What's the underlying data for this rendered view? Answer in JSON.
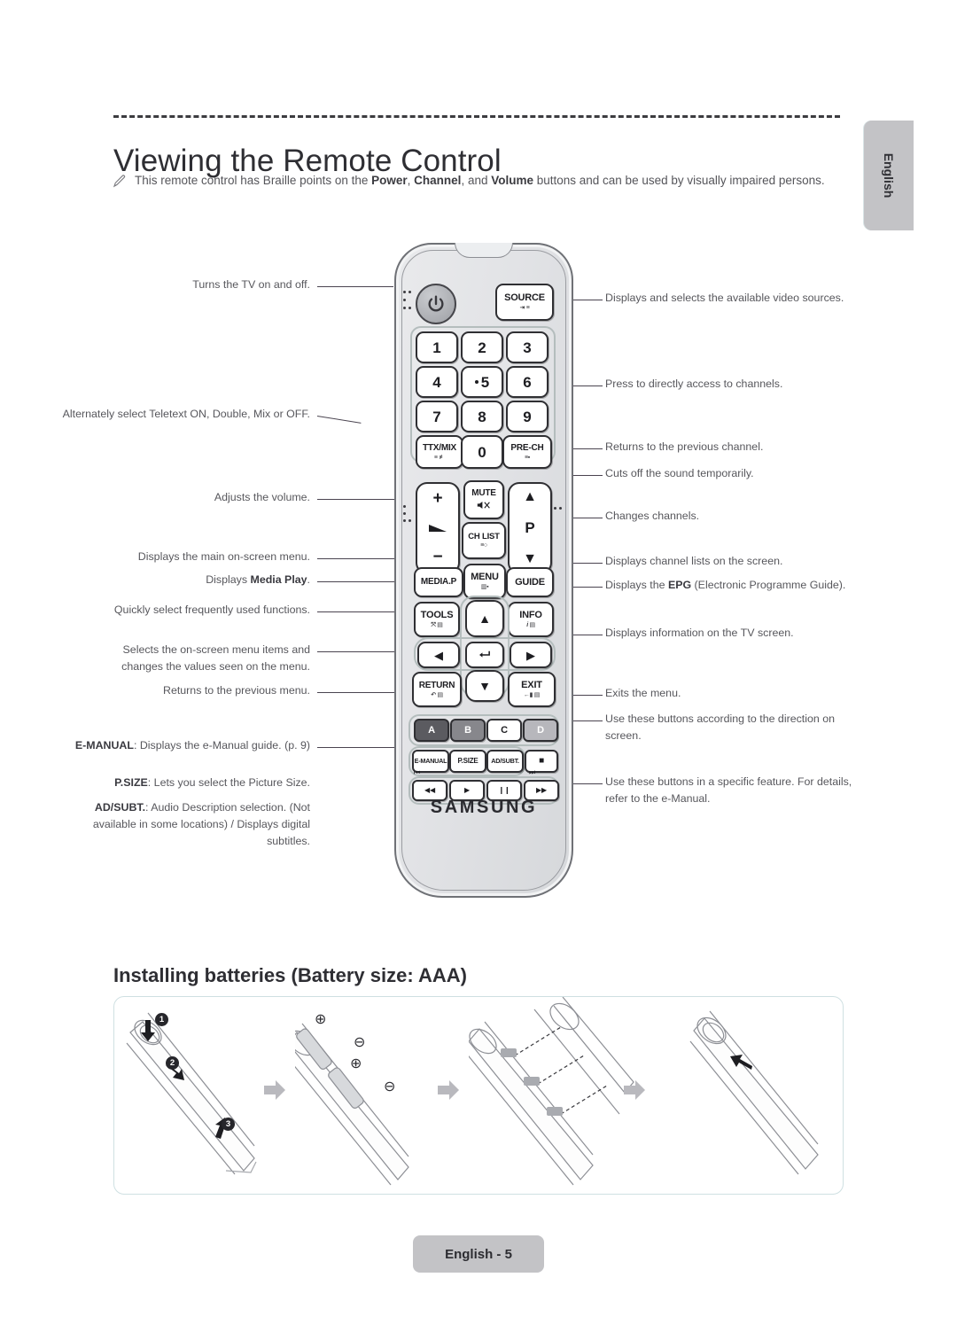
{
  "page": {
    "title": "Viewing the Remote Control",
    "language_tab": "English",
    "footer": "English - 5"
  },
  "note": {
    "icon": "pencil-note-icon",
    "text_parts": [
      {
        "t": "This remote control has Braille points on the ",
        "b": false
      },
      {
        "t": "Power",
        "b": true
      },
      {
        "t": ", ",
        "b": false
      },
      {
        "t": "Channel",
        "b": true
      },
      {
        "t": ", and ",
        "b": false
      },
      {
        "t": "Volume",
        "b": true
      },
      {
        "t": " buttons and can be used by visually impaired persons.",
        "b": false
      }
    ]
  },
  "remote": {
    "brand": "SAMSUNG",
    "buttons": {
      "power": "power-icon",
      "source": {
        "label": "SOURCE",
        "sub": "⇥ ≡"
      },
      "numbers": [
        "1",
        "2",
        "3",
        "4",
        "5",
        "6",
        "7",
        "8",
        "9",
        "0"
      ],
      "ttxmix": {
        "label": "TTX/MIX",
        "sub": "≡ ≢"
      },
      "prech": {
        "label": "PRE-CH",
        "sub": "≡▪"
      },
      "mute": {
        "label": "MUTE",
        "sub": "mute-icon"
      },
      "chlist": {
        "label": "CH LIST",
        "sub": "≡○"
      },
      "volume": {
        "plus": "+",
        "minus": "−",
        "icon": "volume-icon"
      },
      "channel": {
        "up": "▲",
        "down": "▼",
        "label": "P"
      },
      "mediap": {
        "label": "MEDIA.P"
      },
      "menu": {
        "label": "MENU",
        "sub": "▥▪"
      },
      "guide": {
        "label": "GUIDE"
      },
      "tools": {
        "label": "TOOLS",
        "sub": "⤧ ▤"
      },
      "info": {
        "label": "INFO",
        "sub": "i ▤"
      },
      "return": {
        "label": "RETURN",
        "sub": "↶ ▤"
      },
      "exit": {
        "label": "EXIT",
        "sub": "←▮ ▤"
      },
      "enter": "enter-icon",
      "dpad": {
        "up": "▲",
        "down": "▼",
        "left": "◀",
        "right": "▶"
      },
      "color_keys": [
        {
          "label": "A",
          "color": "#5b5b60"
        },
        {
          "label": "B",
          "color": "#87878c"
        },
        {
          "label": "C",
          "color": "#ffffff"
        },
        {
          "label": "D",
          "color": "#b7b7bc"
        }
      ],
      "feature_keys": [
        {
          "label": "E-MANUAL"
        },
        {
          "label": "P.SIZE"
        },
        {
          "label": "AD/SUBT."
        }
      ],
      "stop": {
        "label": "■"
      },
      "transport": [
        {
          "label": "◀◀",
          "top": "⏮"
        },
        {
          "label": "▶",
          "top": ""
        },
        {
          "label": "❙❙",
          "top": ""
        },
        {
          "label": "▶▶",
          "top": "⏭"
        }
      ]
    }
  },
  "callouts": {
    "left": [
      {
        "id": "power",
        "text": "Turns the TV on and off."
      },
      {
        "id": "ttxmix",
        "text": "Alternately select Teletext ON, Double, Mix or OFF."
      },
      {
        "id": "volume",
        "text": "Adjusts the volume."
      },
      {
        "id": "menu",
        "text": "Displays the main on-screen menu."
      },
      {
        "id": "mediap",
        "text": "Displays Media Play.",
        "bold": "Media Play"
      },
      {
        "id": "tools",
        "text": "Quickly select frequently used functions."
      },
      {
        "id": "dpad",
        "text": "Selects the on-screen menu items and changes the values seen on the menu."
      },
      {
        "id": "return",
        "text": "Returns to the previous menu."
      },
      {
        "id": "emanual",
        "text": "E-MANUAL: Displays the e-Manual guide. (p. 9)",
        "bold": "E-MANUAL"
      },
      {
        "id": "psize",
        "text": "P.SIZE: Lets you select the Picture Size.",
        "bold": "P.SIZE"
      },
      {
        "id": "adsubt",
        "text": "AD/SUBT.: Audio Description selection. (Not available in some locations) / Displays digital subtitles.",
        "bold": "AD/SUBT."
      }
    ],
    "right": [
      {
        "id": "source",
        "text": "Displays and selects the available video sources."
      },
      {
        "id": "numbers",
        "text": "Press to directly access to channels."
      },
      {
        "id": "prech",
        "text": "Returns to the previous channel."
      },
      {
        "id": "mute",
        "text": "Cuts off the sound temporarily."
      },
      {
        "id": "channel",
        "text": "Changes channels."
      },
      {
        "id": "chlist",
        "text": "Displays channel lists on the screen."
      },
      {
        "id": "guide",
        "text": "Displays the EPG (Electronic Programme Guide).",
        "bold": "EPG"
      },
      {
        "id": "info",
        "text": "Displays information on the TV screen."
      },
      {
        "id": "exit",
        "text": "Exits the menu."
      },
      {
        "id": "colorkeys",
        "text": "Use these buttons according to the direction on screen."
      },
      {
        "id": "transport",
        "text": "Use these buttons in a specific feature. For details, refer to the e-Manual."
      }
    ]
  },
  "battery": {
    "title": "Installing batteries (Battery size: AAA)",
    "steps": [
      "1",
      "2",
      "3"
    ],
    "polarity": [
      "⊕",
      "⊖",
      "⊕",
      "⊖"
    ],
    "panel_labels": [
      "open-cover",
      "insert-batteries",
      "align-batteries",
      "close-cover"
    ]
  }
}
